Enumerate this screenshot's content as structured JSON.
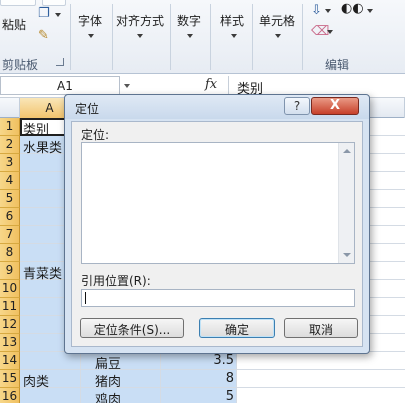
{
  "ribbon": {
    "paste_label": "粘贴",
    "clipboard_group": "剪贴板",
    "font_label": "字体",
    "alignment_label": "对齐方式",
    "number_label": "数字",
    "styles_label": "样式",
    "cells_label": "单元格",
    "editing_group": "编辑"
  },
  "formula_bar": {
    "name_box": "A1",
    "fx": "fx",
    "content": "类别"
  },
  "grid": {
    "col_a": "A",
    "rows": [
      "1",
      "2",
      "3",
      "4",
      "5",
      "6",
      "7",
      "8",
      "9",
      "10",
      "11",
      "12",
      "13",
      "14",
      "15",
      "16"
    ],
    "cells": {
      "a1": "类别",
      "a2": "水果类",
      "a9": "青菜类",
      "b14": "扁豆",
      "c14": "3.5",
      "a15": "肉类",
      "b15": "猪肉",
      "c15": "8",
      "b16": "鸡肉",
      "c16": "5"
    }
  },
  "dialog": {
    "title": "定位",
    "help": "?",
    "close": "X",
    "goto_label": "定位:",
    "reference_label": "引用位置(R):",
    "reference_value": "",
    "special_button": "定位条件(S)...",
    "ok_button": "确定",
    "cancel_button": "取消"
  },
  "colors": {
    "selection": "#c9def5",
    "row_header_selected": "#f0c060",
    "dialog_frame": "#d6e3f2",
    "close_button": "#c7402a"
  }
}
